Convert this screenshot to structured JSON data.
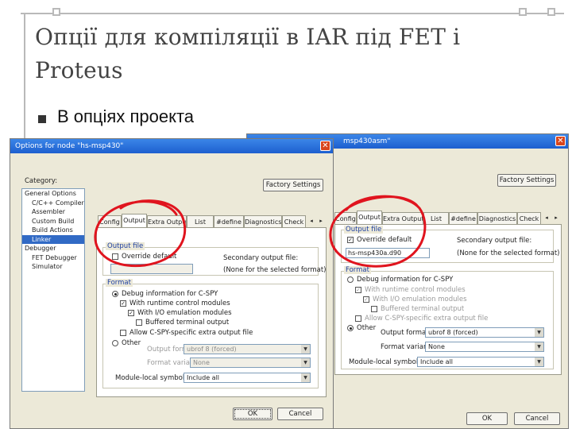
{
  "slide": {
    "title": "Опції для компіляції в IAR під FET і Proteus",
    "bullet": "В опціях проекта"
  },
  "left_dialog": {
    "title": "Options for node \"hs-msp430\"",
    "category_label": "Category:",
    "factory_button": "Factory Settings",
    "categories": [
      {
        "label": "General Options"
      },
      {
        "label": "C/C++ Compiler"
      },
      {
        "label": "Assembler"
      },
      {
        "label": "Custom Build"
      },
      {
        "label": "Build Actions"
      },
      {
        "label": "Linker"
      },
      {
        "label": "Debugger"
      },
      {
        "label": "FET Debugger"
      },
      {
        "label": "Simulator"
      }
    ],
    "tabs": [
      "Config",
      "Output",
      "Extra Output",
      "List",
      "#define",
      "Diagnostics",
      "Check"
    ],
    "output_file_group": "Output file",
    "override_default": "Override default",
    "secondary_label": "Secondary output file:",
    "secondary_value": "(None for the selected format)",
    "format_group": "Format",
    "debug_info": "Debug information for C-SPY",
    "runtime_modules": "With runtime control modules",
    "io_emulation": "With I/O emulation modules",
    "buffered": "Buffered terminal output",
    "allow_cspy": "Allow C-SPY-specific extra output file",
    "other": "Other",
    "output_format_label": "Output format:",
    "output_format_value": "ubrof 8 (forced)",
    "format_variant_label": "Format variant:",
    "format_variant_value": "None",
    "module_local_label": "Module-local symbols:",
    "module_local_value": "Include all",
    "ok_button": "OK",
    "cancel_button": "Cancel"
  },
  "right_dialog": {
    "title": "msp430asm\"",
    "factory_button": "Factory Settings",
    "tabs": [
      "Config",
      "Output",
      "Extra Output",
      "List",
      "#define",
      "Diagnostics",
      "Check"
    ],
    "output_file_group": "Output file",
    "override_default": "Override default",
    "output_file_value": "hs-msp430a.d90",
    "secondary_label": "Secondary output file:",
    "secondary_value": "(None for the selected format)",
    "format_group": "Format",
    "debug_info": "Debug information for C-SPY",
    "runtime_modules": "With runtime control modules",
    "io_emulation": "With I/O emulation modules",
    "buffered": "Buffered terminal output",
    "allow_cspy": "Allow C-SPY-specific extra output file",
    "other": "Other",
    "output_format_label": "Output format:",
    "output_format_value": "ubrof 8 (forced)",
    "format_variant_label": "Format variant:",
    "format_variant_value": "None",
    "module_local_label": "Module-local symbols:",
    "module_local_value": "Include all",
    "ok_button": "OK",
    "cancel_button": "Cancel"
  },
  "colors": {
    "title_text": "#444444",
    "dialog_bg": "#ece9d8",
    "titlebar": "#1d5fcf",
    "annotation_red": "#e0141e",
    "selection": "#316ac5"
  }
}
